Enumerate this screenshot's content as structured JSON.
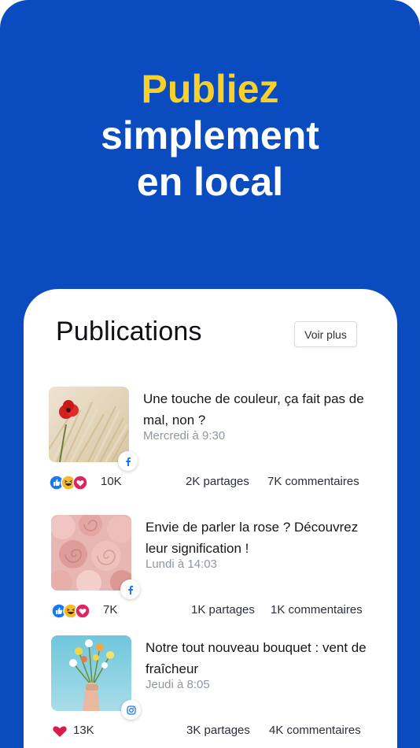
{
  "headline": {
    "accent": "Publiez",
    "line1": "simplement",
    "line2": "en local"
  },
  "colors": {
    "background": "#0a4cc0",
    "accent": "#f7d02a",
    "facebook": "#1877f2",
    "heart": "#e0245e"
  },
  "card": {
    "title": "Publications",
    "see_more_label": "Voir plus"
  },
  "posts": [
    {
      "title": "Une touche de couleur, ça fait pas de mal, non ?",
      "date": "Mercredi à 9:30",
      "network_icon": "facebook-icon",
      "reaction_icons": [
        "like-icon",
        "haha-icon",
        "love-icon"
      ],
      "reactions": "10K",
      "shares": "2K partages",
      "comments": "7K commentaires"
    },
    {
      "title": "Envie de parler la rose ? Découvrez leur signification !",
      "date": "Lundi à 14:03",
      "network_icon": "facebook-icon",
      "reaction_icons": [
        "like-icon",
        "haha-icon",
        "love-icon"
      ],
      "reactions": "7K",
      "shares": "1K partages",
      "comments": "1K commentaires"
    },
    {
      "title": "Notre tout nouveau bouquet : vent de fraîcheur",
      "date": "Jeudi à 8:05",
      "network_icon": "instagram-icon",
      "reaction_icons": [
        "heart-icon"
      ],
      "reactions": "13K",
      "shares": "3K partages",
      "comments": "4K commentaires"
    }
  ]
}
